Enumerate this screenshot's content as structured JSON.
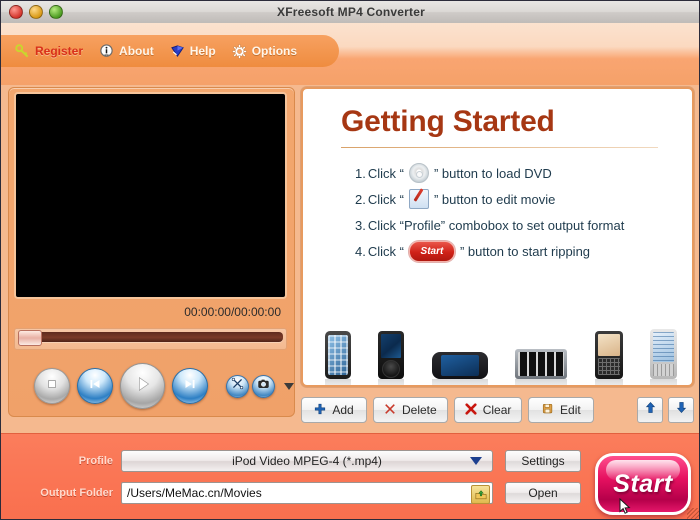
{
  "window": {
    "title": "XFreesoft MP4 Converter",
    "traffic_lights": [
      "close",
      "minimize",
      "maximize"
    ]
  },
  "menu": {
    "items": [
      {
        "label": "Register",
        "icon": "key-icon"
      },
      {
        "label": "About",
        "icon": "info-icon"
      },
      {
        "label": "Help",
        "icon": "book-icon"
      },
      {
        "label": "Options",
        "icon": "gear-icon"
      }
    ]
  },
  "preview": {
    "time_display": "00:00:00/00:00:00",
    "seek_value": 0,
    "controls": [
      {
        "name": "stop-button",
        "icon": "stop-icon"
      },
      {
        "name": "previous-button",
        "icon": "previous-icon"
      },
      {
        "name": "play-button",
        "icon": "play-icon"
      },
      {
        "name": "next-button",
        "icon": "next-icon"
      },
      {
        "name": "crop-button",
        "icon": "crop-icon"
      },
      {
        "name": "snapshot-button",
        "icon": "camera-icon"
      },
      {
        "name": "more-button",
        "icon": "chevron-down-icon"
      }
    ]
  },
  "getting_started": {
    "title": "Getting Started",
    "steps": [
      {
        "number": "1.",
        "pre": "Click “",
        "icon": "dvd-icon",
        "post": "” button to load DVD"
      },
      {
        "number": "2.",
        "pre": "Click “",
        "icon": "edit-icon",
        "post": "” button to edit movie"
      },
      {
        "number": "3.",
        "pre": "Click “Profile” combobox to set output format",
        "icon": "",
        "post": ""
      },
      {
        "number": "4.",
        "pre": "Click “",
        "icon": "start-badge",
        "post": "” button to start ripping",
        "badge_label": "Start"
      }
    ],
    "devices": [
      "iphone",
      "ipod",
      "psp",
      "portable-media-player",
      "blackberry",
      "pda-phone"
    ]
  },
  "file_toolbar": {
    "buttons": [
      {
        "label": "Add",
        "icon": "plus-icon"
      },
      {
        "label": "Delete",
        "icon": "x-thin-icon"
      },
      {
        "label": "Clear",
        "icon": "x-bold-icon"
      },
      {
        "label": "Edit",
        "icon": "save-edit-icon"
      }
    ],
    "move_up": "up-arrow-icon",
    "move_down": "down-arrow-icon"
  },
  "bottom": {
    "profile_label": "Profile",
    "profile_value": "iPod Video MPEG-4 (*.mp4)",
    "settings_label": "Settings",
    "output_label": "Output Folder",
    "output_value": "/Users/MeMac.cn/Movies",
    "open_label": "Open",
    "browse_icon": "folder-upload-icon",
    "start_label": "Start"
  },
  "colors": {
    "header_orange": "#f7a161",
    "bottom_red": "#fa7655",
    "title_maroon": "#a63713",
    "start_pink": "#e61160",
    "register_red": "#d9301a"
  }
}
